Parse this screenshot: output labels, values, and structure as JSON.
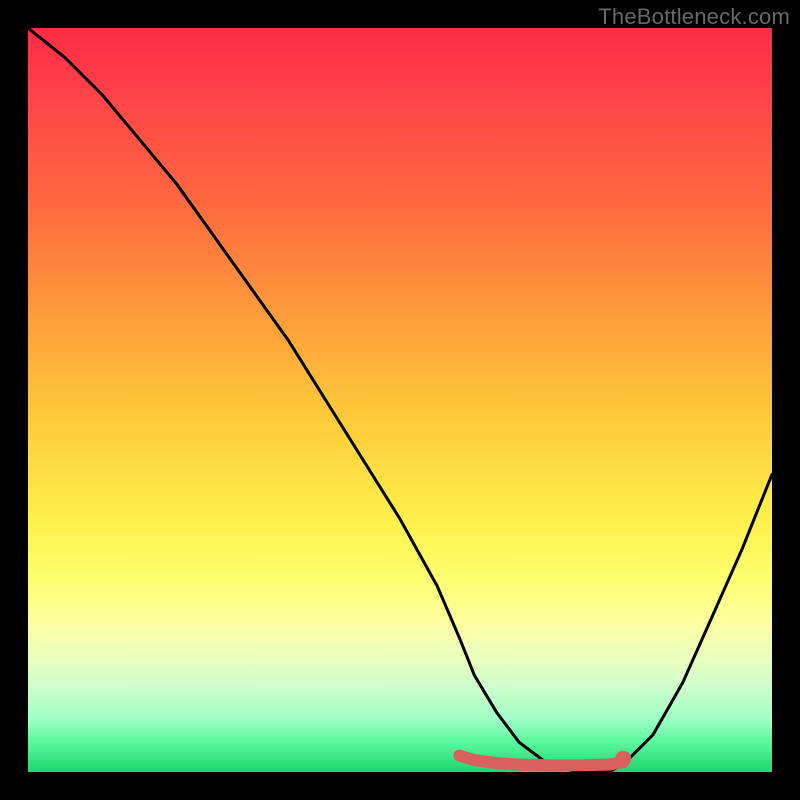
{
  "watermark": "TheBottleneck.com",
  "chart_data": {
    "type": "line",
    "title": "",
    "xlabel": "",
    "ylabel": "",
    "xlim": [
      0,
      100
    ],
    "ylim": [
      0,
      100
    ],
    "series": [
      {
        "name": "bottleneck-curve",
        "x": [
          0,
          5,
          10,
          15,
          20,
          25,
          30,
          35,
          40,
          45,
          50,
          55,
          58,
          60,
          63,
          66,
          70,
          74,
          78,
          80,
          84,
          88,
          92,
          96,
          100
        ],
        "y": [
          100,
          96,
          91,
          85,
          79,
          72,
          65,
          58,
          50,
          42,
          34,
          25,
          18,
          13,
          8,
          4,
          1,
          0,
          0,
          1,
          5,
          12,
          21,
          30,
          40
        ]
      }
    ],
    "highlight_segment": {
      "name": "minimum-flat-region",
      "x": [
        58,
        60,
        63,
        66,
        70,
        74,
        78,
        80
      ],
      "y": [
        2.2,
        1.6,
        1.2,
        1.0,
        0.9,
        0.9,
        1.0,
        1.3
      ],
      "color": "#d8615f",
      "end_dot": {
        "x": 80,
        "y": 1.8,
        "r": 1.2
      }
    },
    "colors": {
      "curve": "#000000",
      "highlight": "#d8615f",
      "gradient_top": "#ff2b45",
      "gradient_bottom": "#1fd66f"
    }
  }
}
